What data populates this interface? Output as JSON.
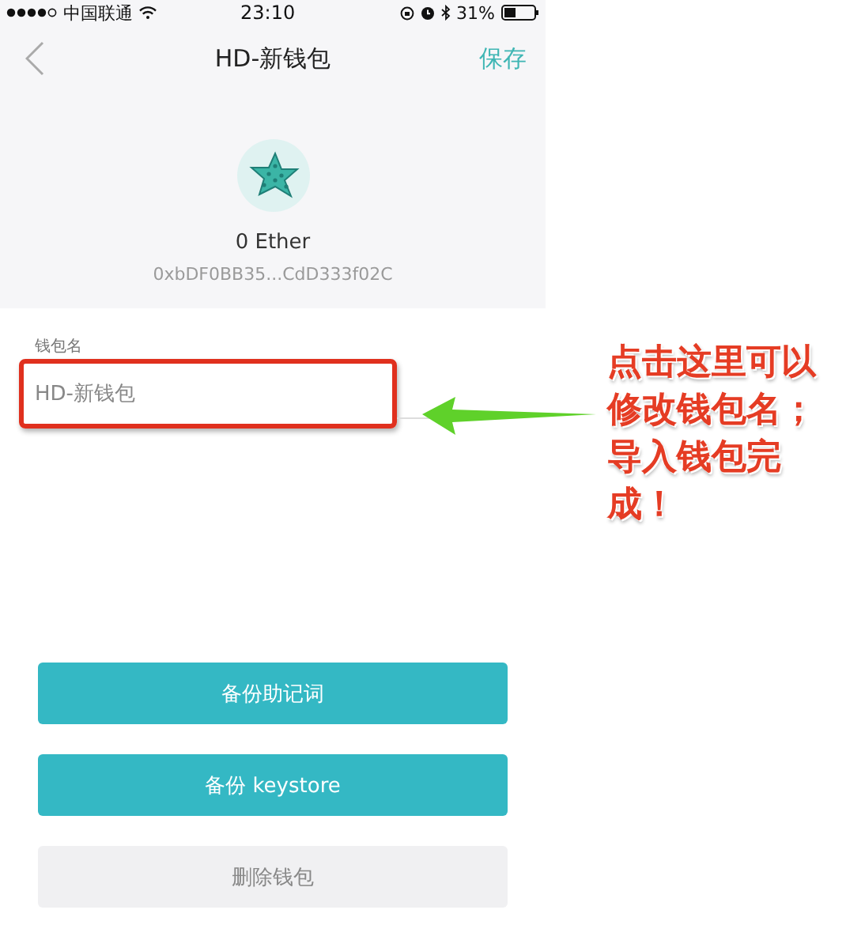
{
  "status_bar": {
    "carrier": "中国联通",
    "time": "23:10",
    "battery": "31%"
  },
  "nav": {
    "title": "HD-新钱包",
    "action": "保存"
  },
  "wallet": {
    "balance": "0 Ether",
    "address": "0xbDF0BB35...CdD333f02C"
  },
  "name_field": {
    "label": "钱包名",
    "placeholder": "HD-新钱包"
  },
  "buttons": [
    {
      "label": "备份助记词",
      "kind": "primary"
    },
    {
      "label": "备份 keystore",
      "kind": "primary"
    },
    {
      "label": "删除钱包",
      "kind": "secondary"
    }
  ],
  "annotation": {
    "lines": [
      "点击这里可以",
      "修改钱包名；",
      "导入钱包完",
      "成！"
    ]
  }
}
